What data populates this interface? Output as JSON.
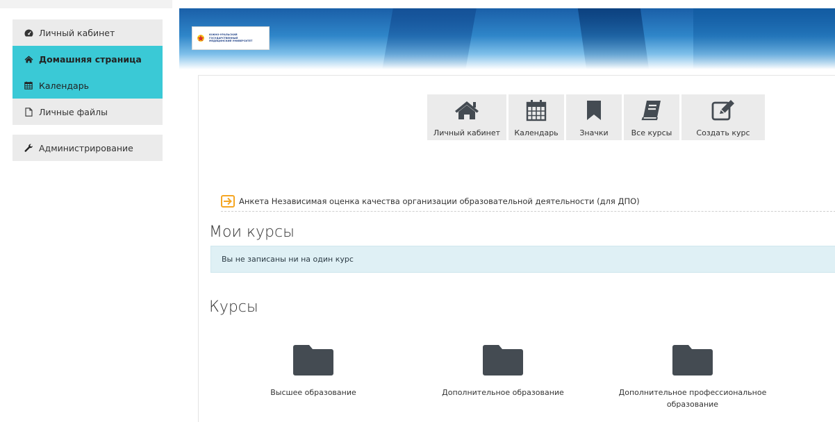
{
  "sidebar": {
    "group1": [
      {
        "label": "Личный кабинет",
        "icon": "dashboard-icon",
        "active": false,
        "bold": false
      },
      {
        "label": "Домашняя страница",
        "icon": "home-icon",
        "active": true,
        "bold": true
      },
      {
        "label": "Календарь",
        "icon": "calendar-icon",
        "active": true,
        "bold": false
      },
      {
        "label": "Личные файлы",
        "icon": "file-icon",
        "active": false,
        "bold": false
      }
    ],
    "group2": [
      {
        "label": "Администрирование",
        "icon": "wrench-icon",
        "active": false,
        "bold": false
      }
    ]
  },
  "header": {
    "logo_lines": [
      "ЮЖНО-УРАЛЬСКИЙ",
      "ГОСУДАРСТВЕННЫЙ",
      "МЕДИЦИНСКИЙ УНИВЕРСИТЕТ"
    ]
  },
  "quick_links": [
    {
      "label": "Личный кабинет",
      "icon": "home-icon"
    },
    {
      "label": "Календарь",
      "icon": "calendar-icon"
    },
    {
      "label": "Значки",
      "icon": "bookmark-icon"
    },
    {
      "label": "Все курсы",
      "icon": "book-icon"
    },
    {
      "label": "Создать курс",
      "icon": "edit-icon"
    }
  ],
  "survey_link": "Анкета Независимая оценка качества организации образовательной деятельности (для ДПО)",
  "my_courses": {
    "title": "Мои курсы",
    "empty_message": "Вы не записаны ни на один курс"
  },
  "courses": {
    "title": "Курсы",
    "categories": [
      "Высшее образование",
      "Дополнительное образование",
      "Дополнительное профессиональное образование"
    ]
  },
  "colors": {
    "accent": "#3ac9d6",
    "alert_bg": "#dff0f5",
    "icon_dark": "#444b52",
    "survey_icon": "#f5a623"
  }
}
